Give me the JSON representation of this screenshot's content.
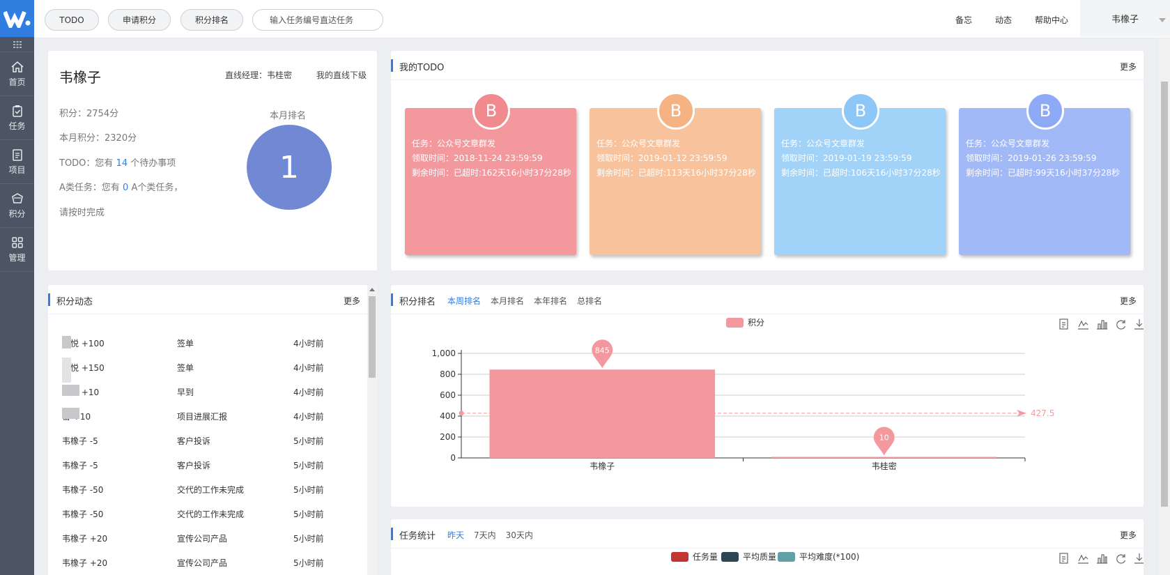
{
  "header": {
    "pills": [
      "TODO",
      "申请积分",
      "积分排名"
    ],
    "search_placeholder": "输入任务编号直达任务",
    "links": [
      "备忘",
      "动态",
      "帮助中心"
    ],
    "user": "韦橡子"
  },
  "sidebar": {
    "items": [
      {
        "label": "首页",
        "icon": "home-icon"
      },
      {
        "label": "任务",
        "icon": "clipboard-icon"
      },
      {
        "label": "项目",
        "icon": "document-icon"
      },
      {
        "label": "积分",
        "icon": "award-icon"
      },
      {
        "label": "管理",
        "icon": "grid-icon"
      }
    ]
  },
  "profile": {
    "name": "韦橡子",
    "manager": "直线经理：韦桂密",
    "subordinates": "我的直线下级",
    "score": "积分：2754分",
    "month_score": "本月积分：2320分",
    "todo_prefix": "TODO：您有",
    "todo_count": "14",
    "todo_suffix": "个待办事项",
    "a_prefix": "A类任务：您有",
    "a_count": "0",
    "a_suffix": "A个类任务，",
    "a_note": "请按时完成",
    "rank_label": "本月排名",
    "rank_value": "1"
  },
  "todo": {
    "title": "我的TODO",
    "more": "更多",
    "cards": [
      {
        "badge": "B",
        "task": "任务：公众号文章群发",
        "claim": "领取时间：2018-11-24 23:59:59",
        "remain": "剩余时间：已超时:162天16小时37分28秒",
        "color": "#f3999e",
        "badge_color": "#f08a8f"
      },
      {
        "badge": "B",
        "task": "任务：公众号文章群发",
        "claim": "领取时间：2019-01-12 23:59:59",
        "remain": "剩余时间：已超时:113天16小时37分28秒",
        "color": "#f8c39c",
        "badge_color": "#f5b283"
      },
      {
        "badge": "B",
        "task": "任务：公众号文章群发",
        "claim": "领取时间：2019-01-19 23:59:59",
        "remain": "剩余时间：已超时:106天16小时37分28秒",
        "color": "#a1d2f8",
        "badge_color": "#8cc7f7"
      },
      {
        "badge": "B",
        "task": "任务：公众号文章群发",
        "claim": "领取时间：2019-01-26 23:59:59",
        "remain": "剩余时间：已超时:99天16小时37分28秒",
        "color": "#a1b9f7",
        "badge_color": "#8ea9f5"
      }
    ]
  },
  "feed": {
    "title": "积分动态",
    "more": "更多",
    "rows": [
      {
        "who": "文悦 +100",
        "what": "签单",
        "when": "4小时前"
      },
      {
        "who": "文悦 +150",
        "what": "签单",
        "when": "4小时前"
      },
      {
        "who": "文悦 +10",
        "what": "早到",
        "when": "4小时前"
      },
      {
        "who": "密 +10",
        "what": "项目进展汇报",
        "when": "4小时前"
      },
      {
        "who": "韦橡子 -5",
        "what": "客户投诉",
        "when": "5小时前"
      },
      {
        "who": "韦橡子 -5",
        "what": "客户投诉",
        "when": "5小时前"
      },
      {
        "who": "韦橡子 -50",
        "what": "交代的工作未完成",
        "when": "5小时前"
      },
      {
        "who": "韦橡子 -50",
        "what": "交代的工作未完成",
        "when": "5小时前"
      },
      {
        "who": "韦橡子 +20",
        "what": "宣传公司产品",
        "when": "5小时前"
      },
      {
        "who": "韦橡子 +20",
        "what": "宣传公司产品",
        "when": "5小时前"
      }
    ]
  },
  "ranking": {
    "title": "积分排名",
    "tabs": [
      "本周排名",
      "本月排名",
      "本年排名",
      "总排名"
    ],
    "more": "更多",
    "average_label": "427.5"
  },
  "stats": {
    "title": "任务统计",
    "tabs": [
      "昨天",
      "7天内",
      "30天内"
    ],
    "more": "更多",
    "legend": [
      {
        "name": "任务量",
        "color": "#c23531"
      },
      {
        "name": "平均质量",
        "color": "#2f4554"
      },
      {
        "name": "平均难度(*100)",
        "color": "#61a0a8"
      }
    ]
  },
  "chart_data": {
    "type": "bar",
    "categories": [
      "韦橡子",
      "韦桂密"
    ],
    "series": [
      {
        "name": "积分",
        "values": [
          845,
          10
        ],
        "color": "#f3999e"
      }
    ],
    "markpoints": [
      845,
      10
    ],
    "markline_average": 427.5,
    "ylim": [
      0,
      1000
    ],
    "yticks": [
      "0",
      "200",
      "400",
      "600",
      "800",
      "1,000"
    ],
    "legend_position": "top-center",
    "grid": true
  }
}
